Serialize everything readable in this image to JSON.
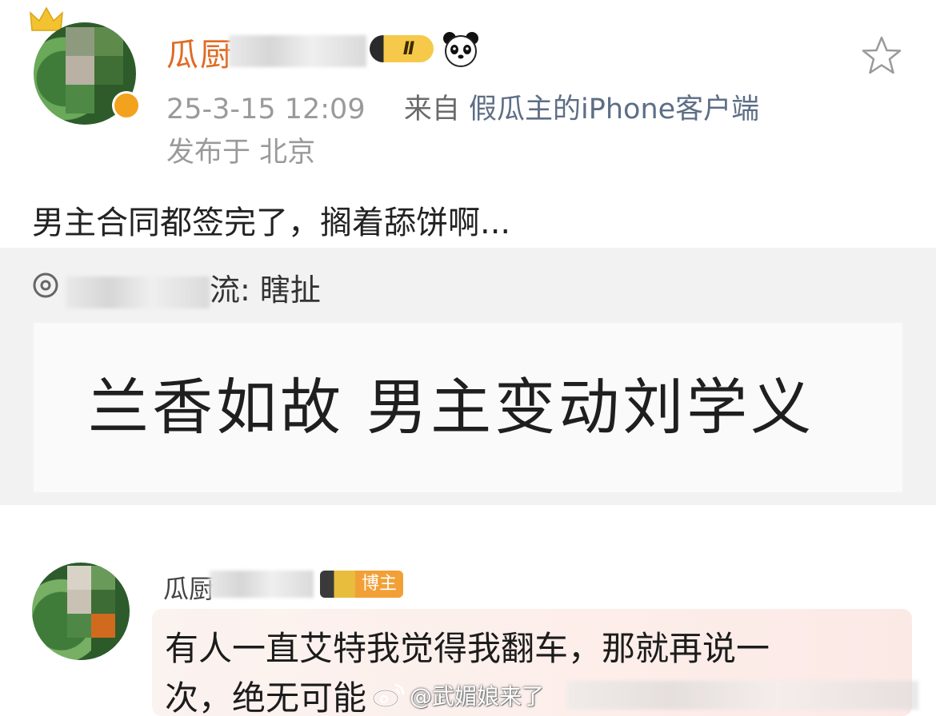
{
  "post": {
    "username": "瓜厨",
    "level_badge": "Ⅱ",
    "datetime": "25-3-15 12:09",
    "source_prefix": "来自",
    "client": "假瓜主的iPhone客户端",
    "location": "发布于 北京",
    "text": "男主合同都签完了，搁着舔饼啊..."
  },
  "repost": {
    "author_suffix": "流",
    "text": "瞎扯",
    "headline": "兰香如故 男主变动刘学义"
  },
  "comment": {
    "username": "瓜厨",
    "blogger_badge": "博主",
    "line1": "有人一直艾特我觉得我翻车，那就再说一",
    "line2": "次，绝无可能"
  },
  "watermark": {
    "text": "@武媚娘来了"
  },
  "colors": {
    "username": "#e06b24",
    "meta": "#9a9a9a",
    "client": "#5e6e86",
    "repost_bg": "#f2f2f2",
    "blogger_badge": "#f2a036",
    "comment_bubble": "#fdeeea"
  },
  "icons": [
    "crown-icon",
    "verified-badge-icon",
    "panda-emoji-icon",
    "favorite-star-icon",
    "at-mention-icon",
    "weibo-logo-icon"
  ]
}
